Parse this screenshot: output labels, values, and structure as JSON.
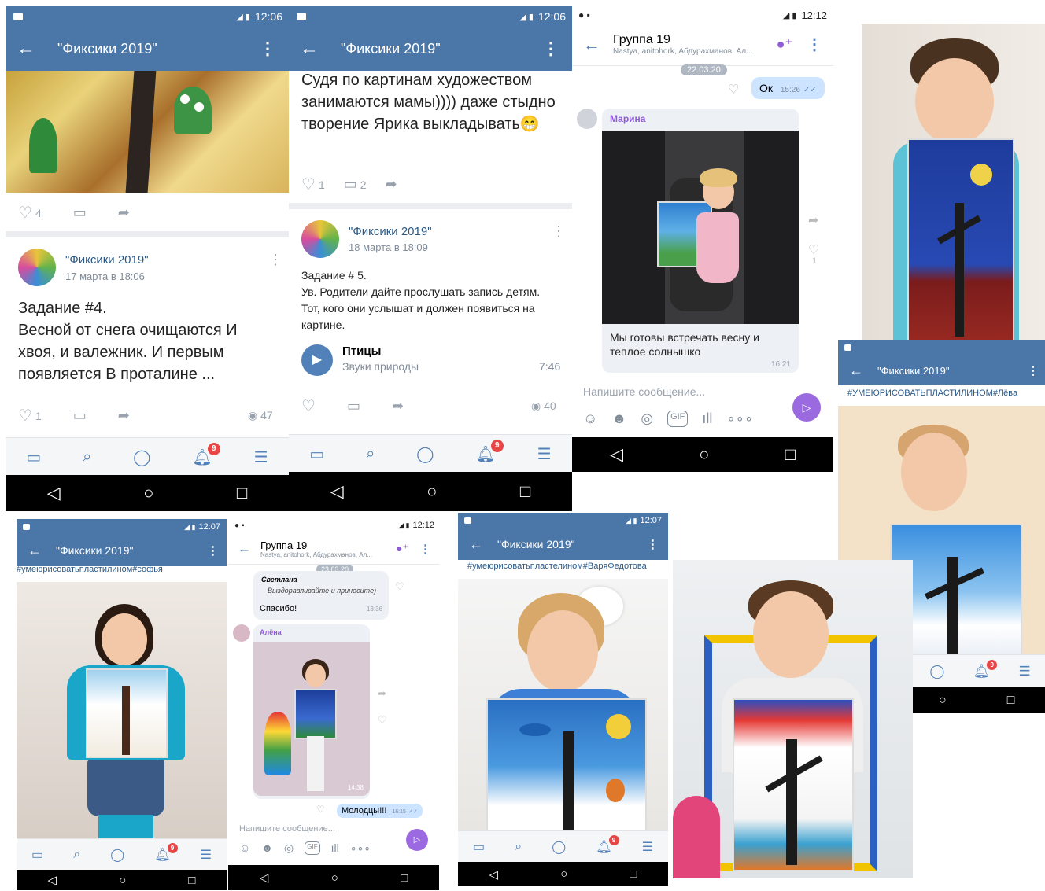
{
  "status": {
    "time1": "12:06",
    "time2": "12:06",
    "time3": "12:12",
    "time4": "12:07",
    "time5": "12:12",
    "time6": "12:07",
    "net": "4G"
  },
  "group_title": "\"Фиксики 2019\"",
  "s1": {
    "likes": "4",
    "post_group": "\"Фиксики 2019\"",
    "post_date": "17 марта в 18:06",
    "post_text": "Задание #4.\nВесной от снега очищаются И хвоя, и валежник. И первым появляется В проталине ...",
    "post_likes": "1",
    "views": "47",
    "badge": "9"
  },
  "s2": {
    "comment_text": "Судя по картинам художеством занимаются мамы)))) даже стыдно творение Ярика выкладывать😁",
    "likes": "1",
    "comments": "2",
    "post_group": "\"Фиксики 2019\"",
    "post_date": "18 марта в 18:09",
    "post_text": "Задание # 5.\nУв. Родители дайте прослушать запись детям. Тот, кого они услышат и должен появиться на картине.",
    "audio_title": "Птицы",
    "audio_artist": "Звуки природы",
    "audio_duration": "7:46",
    "views": "40",
    "badge": "9"
  },
  "s3": {
    "chat_title": "Группа 19",
    "chat_members": "Nastya, anitohork, Абдурахманов, Ал...",
    "date_chip": "22.03.20",
    "my_msg": "Ок",
    "my_time": "15:26",
    "sender": "Марина",
    "caption": "Мы готовы встречать весну и теплое солнышко",
    "caption_time": "16:21",
    "like_count": "1",
    "input_placeholder": "Напишите сообщение..."
  },
  "s5": {
    "tag": "#УМЕЮРИСОВАТЬПЛАСТИЛИНОМ#Лёва",
    "badge": "9"
  },
  "s6": {
    "tag": "#умеюрисоватьпластилином#софья",
    "badge": "9"
  },
  "s7": {
    "chat_title": "Группа 19",
    "chat_members": "Nastya, anitohork, Абдурахманов, Ал...",
    "date_chip": "23.03.20",
    "reply_name": "Светлана",
    "reply_text": "Выздоравливайте и приносите)",
    "thanks": "Спасибо!",
    "thanks_time": "13:36",
    "sender": "Алёна",
    "photo_time": "14:38",
    "my_msg": "Молодцы!!!",
    "my_time": "16:15",
    "input_placeholder": "Напишите сообщение..."
  },
  "s8": {
    "tag": "#умеюрисоватьпластелином#ВаряФедотова",
    "badge": "9"
  },
  "s9": {
    "badge": "9"
  }
}
